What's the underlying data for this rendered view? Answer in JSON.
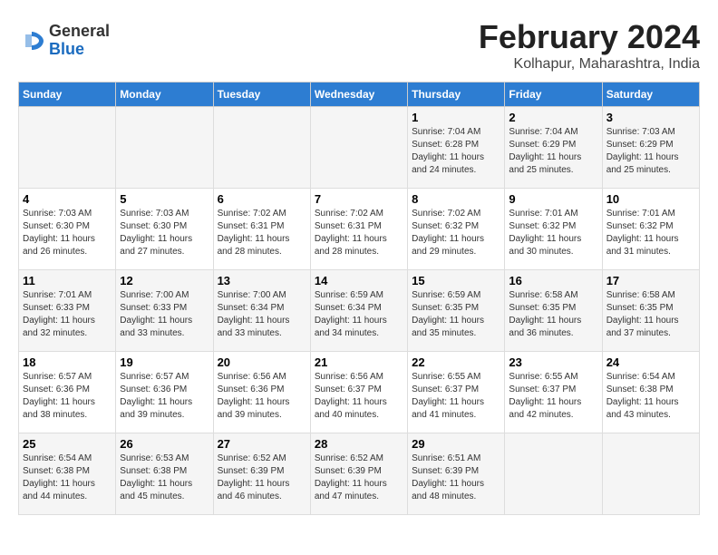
{
  "logo": {
    "general": "General",
    "blue": "Blue"
  },
  "title": "February 2024",
  "subtitle": "Kolhapur, Maharashtra, India",
  "weekdays": [
    "Sunday",
    "Monday",
    "Tuesday",
    "Wednesday",
    "Thursday",
    "Friday",
    "Saturday"
  ],
  "weeks": [
    [
      {
        "day": "",
        "info": ""
      },
      {
        "day": "",
        "info": ""
      },
      {
        "day": "",
        "info": ""
      },
      {
        "day": "",
        "info": ""
      },
      {
        "day": "1",
        "info": "Sunrise: 7:04 AM\nSunset: 6:28 PM\nDaylight: 11 hours\nand 24 minutes."
      },
      {
        "day": "2",
        "info": "Sunrise: 7:04 AM\nSunset: 6:29 PM\nDaylight: 11 hours\nand 25 minutes."
      },
      {
        "day": "3",
        "info": "Sunrise: 7:03 AM\nSunset: 6:29 PM\nDaylight: 11 hours\nand 25 minutes."
      }
    ],
    [
      {
        "day": "4",
        "info": "Sunrise: 7:03 AM\nSunset: 6:30 PM\nDaylight: 11 hours\nand 26 minutes."
      },
      {
        "day": "5",
        "info": "Sunrise: 7:03 AM\nSunset: 6:30 PM\nDaylight: 11 hours\nand 27 minutes."
      },
      {
        "day": "6",
        "info": "Sunrise: 7:02 AM\nSunset: 6:31 PM\nDaylight: 11 hours\nand 28 minutes."
      },
      {
        "day": "7",
        "info": "Sunrise: 7:02 AM\nSunset: 6:31 PM\nDaylight: 11 hours\nand 28 minutes."
      },
      {
        "day": "8",
        "info": "Sunrise: 7:02 AM\nSunset: 6:32 PM\nDaylight: 11 hours\nand 29 minutes."
      },
      {
        "day": "9",
        "info": "Sunrise: 7:01 AM\nSunset: 6:32 PM\nDaylight: 11 hours\nand 30 minutes."
      },
      {
        "day": "10",
        "info": "Sunrise: 7:01 AM\nSunset: 6:32 PM\nDaylight: 11 hours\nand 31 minutes."
      }
    ],
    [
      {
        "day": "11",
        "info": "Sunrise: 7:01 AM\nSunset: 6:33 PM\nDaylight: 11 hours\nand 32 minutes."
      },
      {
        "day": "12",
        "info": "Sunrise: 7:00 AM\nSunset: 6:33 PM\nDaylight: 11 hours\nand 33 minutes."
      },
      {
        "day": "13",
        "info": "Sunrise: 7:00 AM\nSunset: 6:34 PM\nDaylight: 11 hours\nand 33 minutes."
      },
      {
        "day": "14",
        "info": "Sunrise: 6:59 AM\nSunset: 6:34 PM\nDaylight: 11 hours\nand 34 minutes."
      },
      {
        "day": "15",
        "info": "Sunrise: 6:59 AM\nSunset: 6:35 PM\nDaylight: 11 hours\nand 35 minutes."
      },
      {
        "day": "16",
        "info": "Sunrise: 6:58 AM\nSunset: 6:35 PM\nDaylight: 11 hours\nand 36 minutes."
      },
      {
        "day": "17",
        "info": "Sunrise: 6:58 AM\nSunset: 6:35 PM\nDaylight: 11 hours\nand 37 minutes."
      }
    ],
    [
      {
        "day": "18",
        "info": "Sunrise: 6:57 AM\nSunset: 6:36 PM\nDaylight: 11 hours\nand 38 minutes."
      },
      {
        "day": "19",
        "info": "Sunrise: 6:57 AM\nSunset: 6:36 PM\nDaylight: 11 hours\nand 39 minutes."
      },
      {
        "day": "20",
        "info": "Sunrise: 6:56 AM\nSunset: 6:36 PM\nDaylight: 11 hours\nand 39 minutes."
      },
      {
        "day": "21",
        "info": "Sunrise: 6:56 AM\nSunset: 6:37 PM\nDaylight: 11 hours\nand 40 minutes."
      },
      {
        "day": "22",
        "info": "Sunrise: 6:55 AM\nSunset: 6:37 PM\nDaylight: 11 hours\nand 41 minutes."
      },
      {
        "day": "23",
        "info": "Sunrise: 6:55 AM\nSunset: 6:37 PM\nDaylight: 11 hours\nand 42 minutes."
      },
      {
        "day": "24",
        "info": "Sunrise: 6:54 AM\nSunset: 6:38 PM\nDaylight: 11 hours\nand 43 minutes."
      }
    ],
    [
      {
        "day": "25",
        "info": "Sunrise: 6:54 AM\nSunset: 6:38 PM\nDaylight: 11 hours\nand 44 minutes."
      },
      {
        "day": "26",
        "info": "Sunrise: 6:53 AM\nSunset: 6:38 PM\nDaylight: 11 hours\nand 45 minutes."
      },
      {
        "day": "27",
        "info": "Sunrise: 6:52 AM\nSunset: 6:39 PM\nDaylight: 11 hours\nand 46 minutes."
      },
      {
        "day": "28",
        "info": "Sunrise: 6:52 AM\nSunset: 6:39 PM\nDaylight: 11 hours\nand 47 minutes."
      },
      {
        "day": "29",
        "info": "Sunrise: 6:51 AM\nSunset: 6:39 PM\nDaylight: 11 hours\nand 48 minutes."
      },
      {
        "day": "",
        "info": ""
      },
      {
        "day": "",
        "info": ""
      }
    ]
  ]
}
